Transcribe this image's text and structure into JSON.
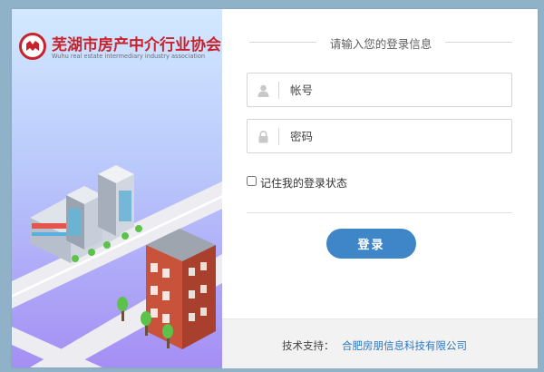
{
  "brand": {
    "name": "芜湖市房产中介行业协会",
    "name_en": "Wuhu real estate intermediary industry association"
  },
  "login": {
    "heading": "请输入您的登录信息",
    "username_placeholder": "帐号",
    "password_placeholder": "密码",
    "remember_label": "记住我的登录状态",
    "remember_checked": false,
    "submit_label": "登录"
  },
  "footer": {
    "support_label": "技术支持：",
    "support_org": "合肥房朋信息科技有限公司"
  },
  "icons": {
    "username": "user-icon",
    "password": "lock-icon",
    "brand": "association-logo-icon"
  },
  "colors": {
    "brand_red": "#c8232c",
    "button_blue": "#3f86c9",
    "link_blue": "#2a78c5",
    "page_bg": "#8fb2c9"
  }
}
